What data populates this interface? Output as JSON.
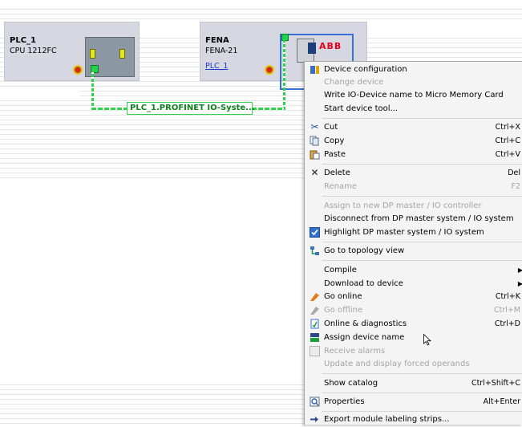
{
  "devices": {
    "plc": {
      "name": "PLC_1",
      "type": "CPU 1212FC"
    },
    "fena": {
      "name": "FENA",
      "type": "FENA-21",
      "link": "PLC_1",
      "logo": "ABB"
    }
  },
  "network": {
    "label": "PLC_1.PROFINET IO-Syste..."
  },
  "menu": {
    "device_config": "Device configuration",
    "change_device": "Change device",
    "write_name": "Write IO-Device name to Micro Memory Card",
    "start_tool": "Start device tool...",
    "cut": "Cut",
    "cut_sc": "Ctrl+X",
    "copy": "Copy",
    "copy_sc": "Ctrl+C",
    "paste": "Paste",
    "paste_sc": "Ctrl+V",
    "delete": "Delete",
    "delete_sc": "Del",
    "rename": "Rename",
    "rename_sc": "F2",
    "assign_master": "Assign to new DP master / IO controller",
    "disconnect": "Disconnect from DP master system / IO system",
    "highlight": "Highlight DP master system / IO system",
    "topology": "Go to topology view",
    "compile": "Compile",
    "download": "Download to device",
    "go_online": "Go online",
    "go_online_sc": "Ctrl+K",
    "go_offline": "Go offline",
    "go_offline_sc": "Ctrl+M",
    "diagnostics": "Online & diagnostics",
    "diagnostics_sc": "Ctrl+D",
    "assign_name": "Assign device name",
    "receive_alarms": "Receive alarms",
    "forced_operands": "Update and display forced operands",
    "show_catalog": "Show catalog",
    "show_catalog_sc": "Ctrl+Shift+C",
    "properties": "Properties",
    "properties_sc": "Alt+Enter",
    "export": "Export module labeling strips..."
  },
  "icons": {
    "device_config": "device-config-icon",
    "cut": "scissors-icon",
    "copy": "copy-icon",
    "paste": "paste-icon",
    "delete": "delete-x-icon",
    "highlight": "checkbox-checked-icon",
    "topology": "topology-icon",
    "go_online": "go-online-icon",
    "go_offline": "go-offline-icon",
    "diagnostics": "diagnostics-icon",
    "assign_name": "assign-name-icon",
    "receive_alarms": "checkbox-empty-icon",
    "properties": "properties-icon",
    "export": "export-arrow-icon"
  },
  "colors": {
    "network_green": "#2fd44b",
    "selection_blue": "#3a6fd8",
    "link_blue": "#1a3cc8",
    "abb_red": "#e2001a"
  }
}
